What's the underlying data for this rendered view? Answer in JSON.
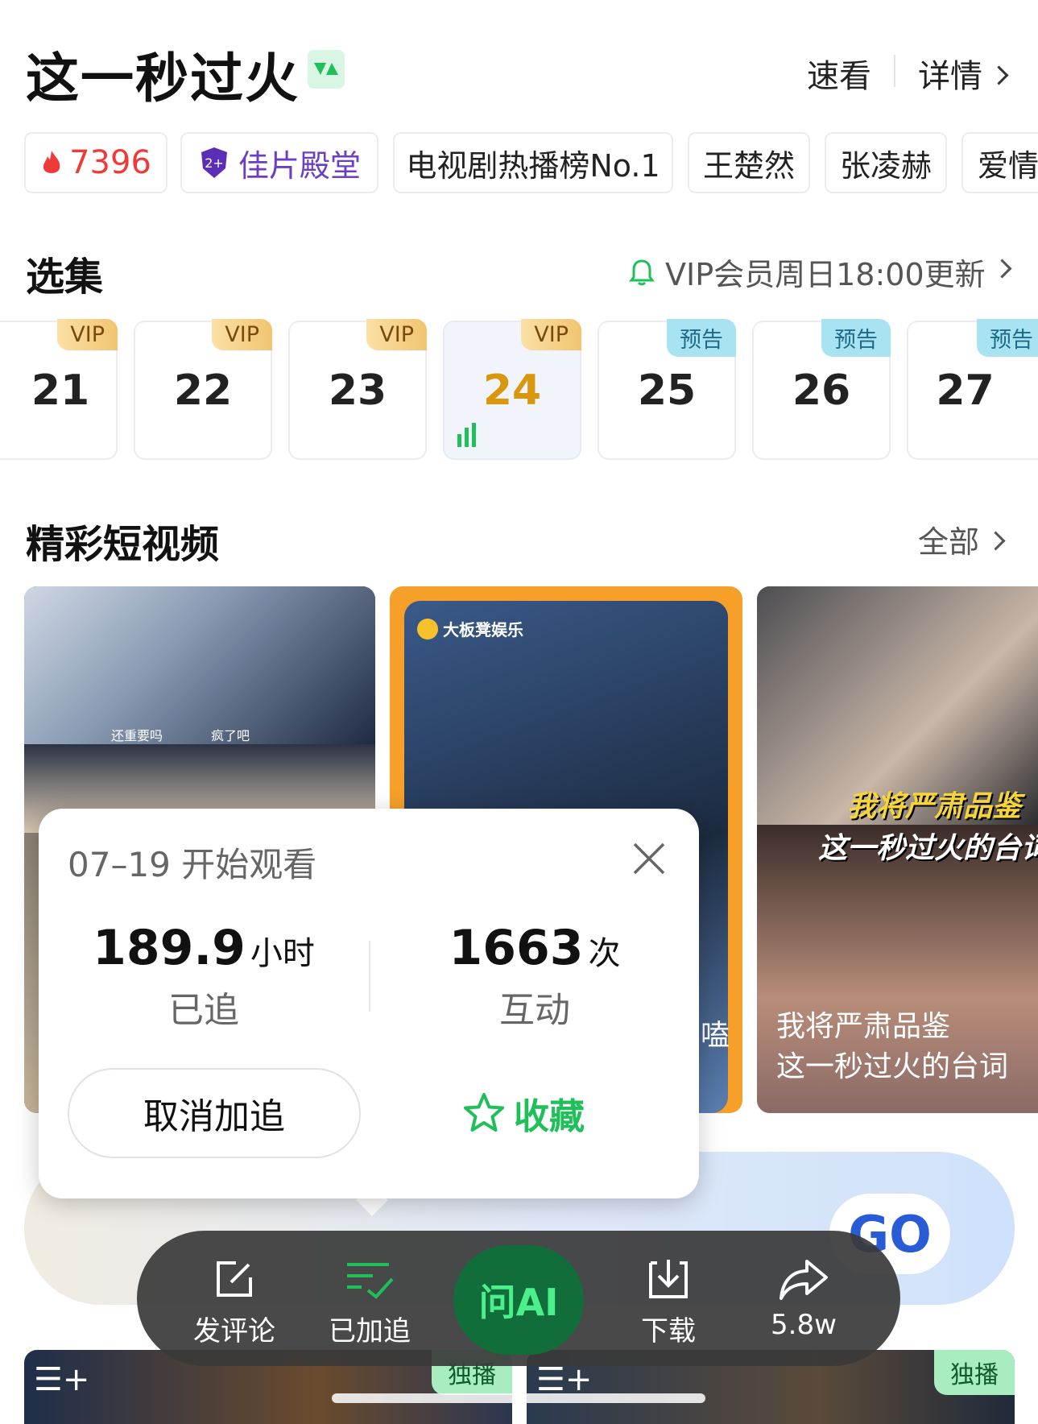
{
  "header": {
    "title": "这一秒过火",
    "quick_view": "速看",
    "details": "详情"
  },
  "tags": [
    {
      "label": "7396",
      "kind": "hot"
    },
    {
      "label": "佳片殿堂",
      "kind": "award"
    },
    {
      "label": "电视剧热播榜No.1"
    },
    {
      "label": "王楚然"
    },
    {
      "label": "张凌赫"
    },
    {
      "label": "爱情"
    }
  ],
  "episodes_section": {
    "title": "选集",
    "update_note": "VIP会员周日18:00更新",
    "episodes": [
      {
        "num": "21",
        "badge": "VIP"
      },
      {
        "num": "22",
        "badge": "VIP"
      },
      {
        "num": "23",
        "badge": "VIP"
      },
      {
        "num": "24",
        "badge": "VIP",
        "playing": true
      },
      {
        "num": "25",
        "badge": "预告"
      },
      {
        "num": "26",
        "badge": "预告"
      },
      {
        "num": "27",
        "badge": "预告"
      }
    ]
  },
  "shorts_section": {
    "title": "精彩短视频",
    "all_label": "全部",
    "cards": [
      {
        "captions": [
          "还重要吗",
          "疯了吧"
        ]
      },
      {
        "brand": "大板凳娱乐",
        "edge_text": "嗑"
      },
      {
        "overlay_title_1": "我将严肃品鉴",
        "overlay_title_2": "这一秒过火的台词",
        "caption": "我将严肃品鉴\n这一秒过火的台词"
      }
    ]
  },
  "banner": {
    "go_label": "GO"
  },
  "popup": {
    "start_date": "07–19 开始观看",
    "hours_value": "189.9",
    "hours_unit": "小时",
    "hours_label": "已追",
    "interactions_value": "1663",
    "interactions_unit": "次",
    "interactions_label": "互动",
    "cancel_label": "取消加追",
    "favorite_label": "收藏"
  },
  "bottom_bar": {
    "comment": "发评论",
    "followed": "已加追",
    "ask_ai": "问AI",
    "download": "下载",
    "share_count": "5.8w"
  },
  "bottom_cards": [
    {
      "badge": "独播"
    },
    {
      "badge": "独播"
    }
  ],
  "colors": {
    "accent_green": "#1fbf5a",
    "vip_gold": "#d8970c",
    "hot_red": "#f03a3a",
    "award_purple": "#6b3fc4"
  }
}
